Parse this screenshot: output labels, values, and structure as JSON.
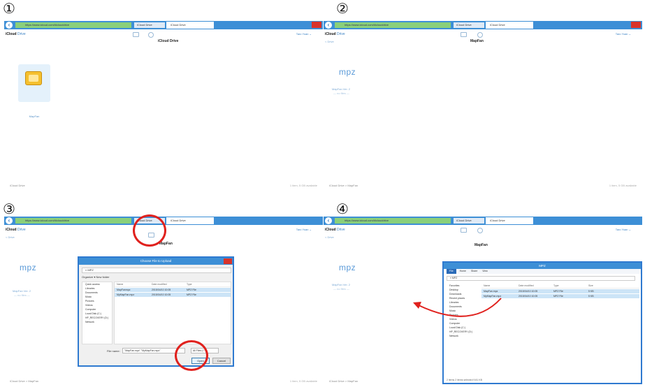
{
  "steps": [
    "①",
    "②",
    "③",
    "④"
  ],
  "browser": {
    "url": "https://www.icloud.com/#iclouddrive",
    "tab_inactive": "iCloud Drive",
    "tab_active": "iCloud Drive",
    "back_icon": "arrow-left-icon"
  },
  "icloud": {
    "brand": "iCloud",
    "section": "Drive",
    "section_caret": "⌄",
    "user_menu": "Taro Yoan ⌄",
    "back_link": "< Drive"
  },
  "panel1": {
    "center_title": "iCloud Drive",
    "folder_label": "MapFan",
    "footer_left": "iCloud Drive",
    "footer_right": "1 item, 5 GB available"
  },
  "panel2": {
    "center_title": "MapFan",
    "file_type": "mpz",
    "file_link": "MapFan Ver. 2",
    "file_sub": "— no files —",
    "footer_left": "iCloud Drive  >  MapFan",
    "footer_right": "1 item, 5 GB available"
  },
  "panel3": {
    "center_title": "MapFan",
    "file_type": "mpz",
    "file_link": "MapFan Ver. 2",
    "file_sub": "— no files —",
    "footer_left": "iCloud Drive  >  MapFan",
    "footer_right": "1 item, 5 GB available",
    "dialog": {
      "title": "Choose File to Upload",
      "address": "« MPZ",
      "toolbar": "Organize ▾    New folder",
      "nav_items": [
        "Quick access",
        "Libraries",
        "Documents",
        "Music",
        "Pictures",
        "Videos",
        "Computer",
        "Local Disk (C:)",
        "HP_RECOVERY (D:)",
        "Network"
      ],
      "columns": [
        "Name",
        "Date modified",
        "Type"
      ],
      "files": [
        {
          "name": "MapFanmpz",
          "date": "2015/04/10 10:05",
          "type": "MPZ File"
        },
        {
          "name": "MyMapFan.mpz",
          "date": "2015/04/10 10:05",
          "type": "MPZ File"
        }
      ],
      "filename_label": "File name:",
      "filename_value": "\"MapFan.mpz\" \"MyMapFan.mpz\"",
      "filter": "All Files (*.*)",
      "open_label": "Open",
      "cancel_label": "Cancel"
    }
  },
  "panel4": {
    "center_title": "MapFan",
    "file_type": "mpz",
    "file_link": "MapFan Ver. 2",
    "file_sub": "— no files —",
    "footer_left": "iCloud Drive  >  MapFan",
    "footer_right": "1 item, 5 GB available",
    "explorer": {
      "title": "MPZ",
      "ribbon_tabs": [
        "File",
        "Home",
        "Share",
        "View"
      ],
      "address": "« MPZ",
      "nav_items": [
        "Favorites",
        "Desktop",
        "Downloads",
        "Recent places",
        "Libraries",
        "Documents",
        "Music",
        "Pictures",
        "Videos",
        "Computer",
        "Local Disk (C:)",
        "HP_RECOVERY (D:)",
        "Network"
      ],
      "columns": [
        "Name",
        "Date modified",
        "Type",
        "Size"
      ],
      "files": [
        {
          "name": "MapFan.mpz",
          "date": "2015/04/10 10:05",
          "type": "MPZ File",
          "size": "5 KB"
        },
        {
          "name": "MyMapFan.mpz",
          "date": "2015/04/10 10:05",
          "type": "MPZ File",
          "size": "5 KB"
        }
      ],
      "status": "2 items   2 items selected  9.81 KB"
    }
  },
  "colors": {
    "chrome_blue": "#3d8fd6",
    "address_green": "#8ad07a",
    "highlight_red": "#e0211d",
    "folder_yellow": "#f5c02e",
    "selection": "#cce4f7"
  }
}
